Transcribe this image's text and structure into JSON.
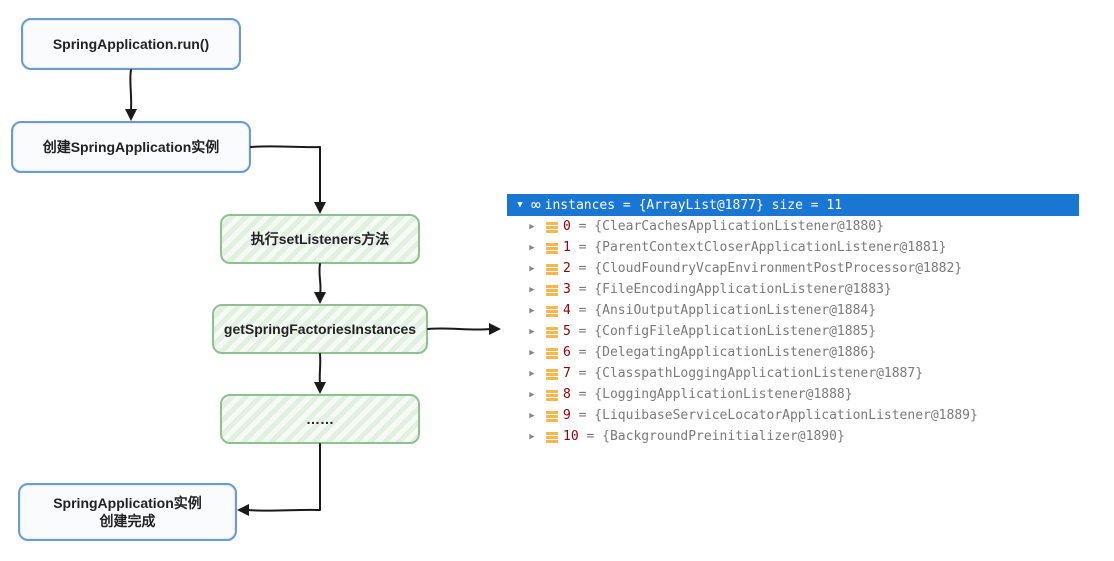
{
  "flow": {
    "n1": "SpringApplication.run()",
    "n2": "创建SpringApplication实例",
    "n3": "执行setListeners方法",
    "n4": "getSpringFactoriesInstances",
    "n5": "……",
    "n6": "SpringApplication实例\n创建完成"
  },
  "debugger": {
    "headerVar": "instances",
    "headerValue": "= {ArrayList@1877}  size = 11",
    "items": [
      {
        "index": "0",
        "value": "= {ClearCachesApplicationListener@1880}"
      },
      {
        "index": "1",
        "value": "= {ParentContextCloserApplicationListener@1881}"
      },
      {
        "index": "2",
        "value": "= {CloudFoundryVcapEnvironmentPostProcessor@1882}"
      },
      {
        "index": "3",
        "value": "= {FileEncodingApplicationListener@1883}"
      },
      {
        "index": "4",
        "value": "= {AnsiOutputApplicationListener@1884}"
      },
      {
        "index": "5",
        "value": "= {ConfigFileApplicationListener@1885}"
      },
      {
        "index": "6",
        "value": "= {DelegatingApplicationListener@1886}"
      },
      {
        "index": "7",
        "value": "= {ClasspathLoggingApplicationListener@1887}"
      },
      {
        "index": "8",
        "value": "= {LoggingApplicationListener@1888}"
      },
      {
        "index": "9",
        "value": "= {LiquibaseServiceLocatorApplicationListener@1889}"
      },
      {
        "index": "10",
        "value": "= {BackgroundPreinitializer@1890}"
      }
    ]
  }
}
